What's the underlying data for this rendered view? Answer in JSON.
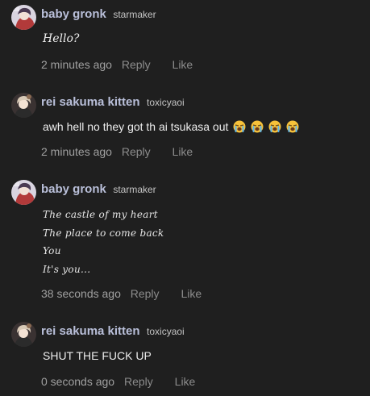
{
  "comments": [
    {
      "author": "baby gronk",
      "handle": "starmaker",
      "text_lines": [
        "Hello?"
      ],
      "time": "2 minutes ago",
      "reply_label": "Reply",
      "like_label": "Like",
      "style": "script-single"
    },
    {
      "author": "rei sakuma kitten",
      "handle": "toxicyaoi",
      "text_lines": [
        "awh hell no they got th ai tsukasa out"
      ],
      "emoji": [
        "loudly-crying-face",
        "loudly-crying-face",
        "loudly-crying-face",
        "loudly-crying-face"
      ],
      "time": "2 minutes ago",
      "reply_label": "Reply",
      "like_label": "Like",
      "style": "plain"
    },
    {
      "author": "baby gronk",
      "handle": "starmaker",
      "text_lines": [
        "The castle of my heart",
        "The place to come back",
        "You",
        "It's you..."
      ],
      "time": "38 seconds ago",
      "reply_label": "Reply",
      "like_label": "Like",
      "style": "script"
    },
    {
      "author": "rei sakuma kitten",
      "handle": "toxicyaoi",
      "text_lines": [
        "SHUT THE FUCK UP"
      ],
      "time": "0 seconds ago",
      "reply_label": "Reply",
      "like_label": "Like",
      "style": "plain"
    }
  ],
  "colors": {
    "background": "#1f1f1f",
    "author": "#b9bfd9",
    "meta": "#a0a0a0"
  }
}
